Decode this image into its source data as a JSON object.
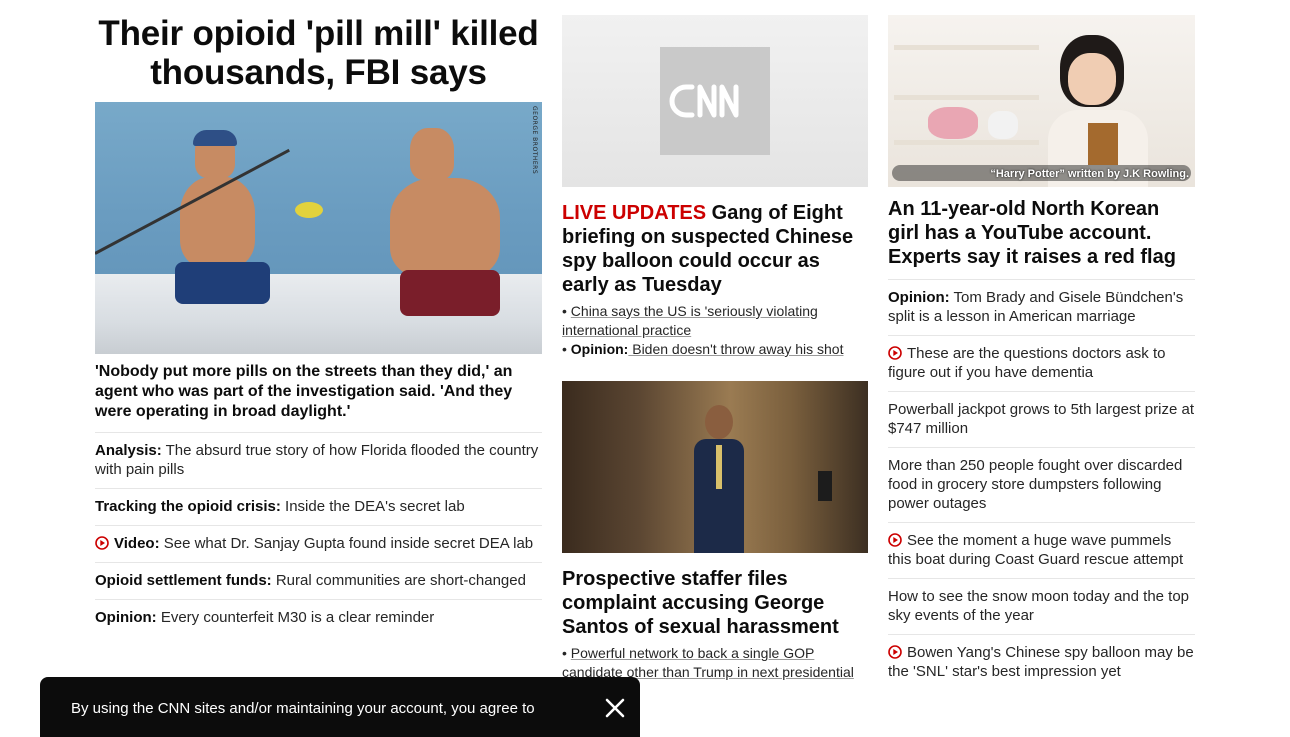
{
  "lead": {
    "headline": "Their opioid 'pill mill' killed thousands, FBI says",
    "image_credit": "GEORGE BROTHERS",
    "summary": "'Nobody put more pills on the streets than they did,' an agent who was part of the investigation said. 'And they were operating in broad daylight.'",
    "links": [
      {
        "prefix": "Analysis:",
        "text": " The absurd true story of how Florida flooded the country with pain pills",
        "video": false
      },
      {
        "prefix": "Tracking the opioid crisis:",
        "text": " Inside the DEA's secret lab",
        "video": false
      },
      {
        "prefix": "Video:",
        "text": " See what Dr. Sanjay Gupta found inside secret DEA lab",
        "video": true
      },
      {
        "prefix": "Opioid settlement funds:",
        "text": " Rural communities are short-changed",
        "video": false
      },
      {
        "prefix": "Opinion:",
        "text": " Every counterfeit M30 is a clear reminder",
        "video": false
      }
    ]
  },
  "middle": {
    "live_label": "LIVE UPDATES",
    "balloon_headline": " Gang of Eight briefing on suspected Chinese spy balloon could occur as early as Tuesday",
    "balloon_bullets": [
      {
        "prefix": "",
        "text": "China says the US is 'seriously violating international practice"
      },
      {
        "prefix": "Opinion:",
        "text": " Biden doesn't throw away his shot"
      }
    ],
    "santos_headline": "Prospective staffer files complaint accusing George Santos of sexual harassment",
    "santos_bullets": [
      {
        "prefix": "",
        "text": "Powerful network to back a single GOP candidate other than Trump in next presidential el"
      }
    ]
  },
  "right": {
    "video_caption": "“Harry Potter” written by J.K Rowling.",
    "headline": "An 11-year-old North Korean girl has a YouTube account. Experts say it raises a red flag",
    "links": [
      {
        "prefix": "Opinion:",
        "text": " Tom Brady and Gisele Bündchen's split is a lesson in American marriage",
        "video": false
      },
      {
        "prefix": "",
        "text": "These are the questions doctors ask to figure out if you have dementia",
        "video": true
      },
      {
        "prefix": "",
        "text": "Powerball jackpot grows to 5th largest prize at $747 million",
        "video": false
      },
      {
        "prefix": "",
        "text": "More than 250 people fought over discarded food in grocery store dumpsters following power outages",
        "video": false
      },
      {
        "prefix": "",
        "text": "See the moment a huge wave pummels this boat during Coast Guard rescue attempt",
        "video": true
      },
      {
        "prefix": "",
        "text": "How to see the snow moon today and the top sky events of the year",
        "video": false
      },
      {
        "prefix": "",
        "text": "Bowen Yang's Chinese spy balloon may be the 'SNL' star's best impression yet",
        "video": true
      }
    ]
  },
  "consent": {
    "text": "By using the CNN sites and/or maintaining your account, you agree to"
  },
  "colors": {
    "accent_red": "#cc0000",
    "text": "#0c0c0c",
    "divider": "#e6e6e6"
  }
}
